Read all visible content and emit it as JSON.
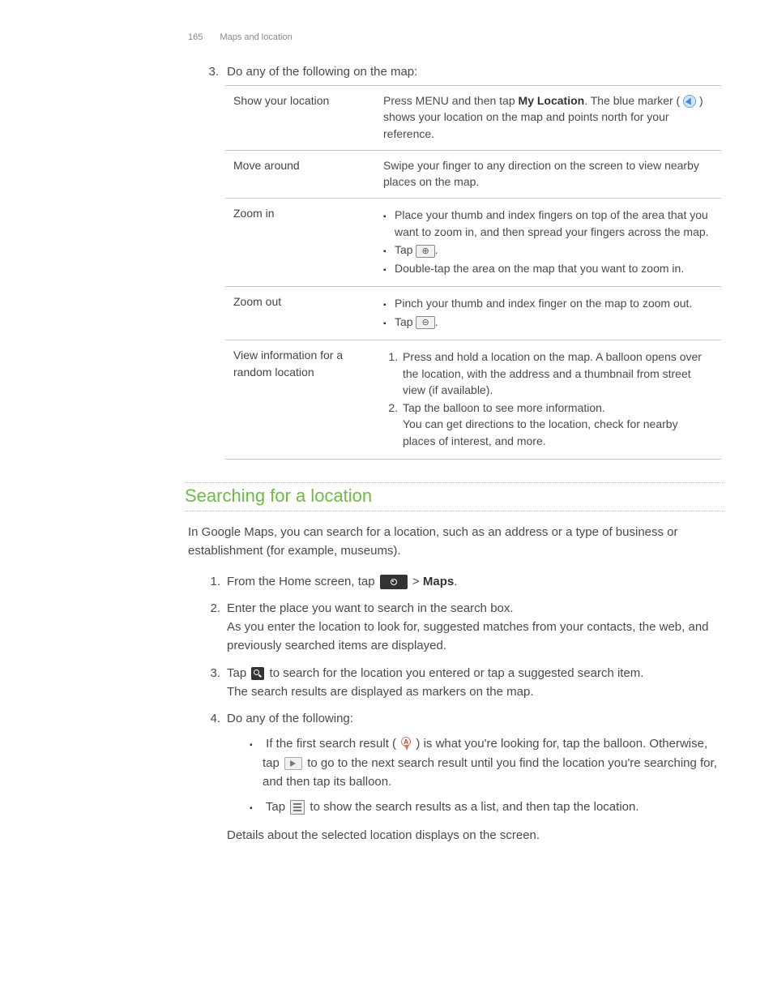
{
  "header": {
    "page_number": "165",
    "section": "Maps and location"
  },
  "step3_intro": "Do any of the following on the map:",
  "table": {
    "rows": [
      {
        "label": "Show your location",
        "desc_pre": "Press MENU and then tap ",
        "desc_bold": "My Location",
        "desc_post": ". The blue marker ( ",
        "desc_end": " ) shows your location on the map and points north for your reference."
      },
      {
        "label": "Move around",
        "desc": "Swipe your finger to any direction on the screen to view nearby places on the map."
      },
      {
        "label": "Zoom in",
        "items": [
          "Place your thumb and index fingers on top of the area that you want to zoom in, and then spread your fingers across the map.",
          "Tap",
          "Double-tap the area on the map that you want to zoom in."
        ],
        "zoom_icon_label": "⊕"
      },
      {
        "label": "Zoom out",
        "items": [
          "Pinch your thumb and index finger on the map to zoom out.",
          "Tap"
        ],
        "zoom_icon_label": "⊖"
      },
      {
        "label": "View information for a random location",
        "ordered": [
          "Press and hold a location on the map. A balloon opens over the location, with the address and a thumbnail from street view (if available).",
          "Tap the balloon to see more information."
        ],
        "ordered_extra": "You can get directions to the location, check for nearby places of interest, and more."
      }
    ]
  },
  "section2": {
    "title": "Searching for a location",
    "intro": "In Google Maps, you can search for a location, such as an address or a type of business or establishment (for example, museums).",
    "steps": [
      {
        "pre": "From the Home screen, tap ",
        "post": " > ",
        "bold": "Maps",
        "end": "."
      },
      {
        "line1": "Enter the place you want to search in the search box.",
        "line2": "As you enter the location to look for, suggested matches from your contacts, the web, and previously searched items are displayed."
      },
      {
        "pre": "Tap ",
        "mid": " to search for the location you entered or tap a suggested search item.",
        "line2": "The search results are displayed as markers on the map."
      },
      {
        "text": "Do any of the following:",
        "sub": [
          {
            "pre": "If the first search result ( ",
            "mid": " ) is what you're looking for, tap the balloon. Otherwise, tap ",
            "mid2": " to go to the next search result until you find the location you're searching for, and then tap its balloon."
          },
          {
            "pre": "Tap ",
            "post": " to show the search results as a list, and then tap the location."
          }
        ],
        "outro": "Details about the selected location displays on the screen."
      }
    ]
  }
}
